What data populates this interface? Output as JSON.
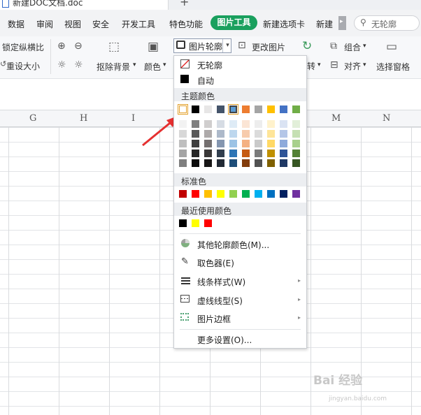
{
  "window": {
    "doc_tab_title": "新建DOC文档.doc",
    "add_tab": "+"
  },
  "menu": {
    "items": [
      "数据",
      "审阅",
      "视图",
      "安全",
      "开发工具",
      "特色功能",
      "图片工具",
      "新建选项卡",
      "新建"
    ],
    "active": "图片工具",
    "more_arrow": "▸",
    "search_placeholder": "无轮廓"
  },
  "ribbon": {
    "lock_ratio": "锁定纵横比",
    "reset_size": "重设大小",
    "remove_bg": "抠除背景",
    "color": "颜色",
    "outline": "图片轮廓",
    "change_picture": "更改图片",
    "combine": "组合",
    "align": "对齐",
    "selection_pane": "选择窗格",
    "rotate": "转",
    "dropdown_glyph": "▾"
  },
  "columns": [
    "G",
    "H",
    "I",
    "M",
    "N"
  ],
  "outline_menu": {
    "no_outline": "无轮廓",
    "automatic": "自动",
    "theme_colors_header": "主题颜色",
    "standard_colors_header": "标准色",
    "recent_colors_header": "最近使用颜色",
    "more_colors": "其他轮廓颜色(M)...",
    "eyedropper": "取色器(E)",
    "line_style": "线条样式(W)",
    "dash_style": "虚线线型(S)",
    "picture_border": "图片边框",
    "more_settings": "更多设置(O)...",
    "submenu_arrow": "▸",
    "theme_top": [
      "#ffffff",
      "#000000",
      "#e7e6e6",
      "#44546a",
      "#5b9bd5",
      "#ed7d31",
      "#a5a5a5",
      "#ffc000",
      "#4472c4",
      "#70ad47"
    ],
    "theme_tints": [
      [
        "#f2f2f2",
        "#7f7f7f",
        "#d0cece",
        "#d6dce4",
        "#deebf6",
        "#fbe5d5",
        "#ededed",
        "#fff2cc",
        "#dae3f3",
        "#e2efd9"
      ],
      [
        "#d8d8d8",
        "#595959",
        "#aeaaaa",
        "#adb9ca",
        "#bdd7ee",
        "#f7cbac",
        "#dbdbdb",
        "#fee599",
        "#b4c6e7",
        "#c5e0b3"
      ],
      [
        "#bfbfbf",
        "#3f3f3f",
        "#757070",
        "#8496b0",
        "#9cc3e5",
        "#f4b183",
        "#c9c9c9",
        "#ffd965",
        "#8eaadb",
        "#a8d08d"
      ],
      [
        "#a5a5a5",
        "#262626",
        "#3a3838",
        "#323f4f",
        "#2e75b5",
        "#c55a11",
        "#7b7b7b",
        "#bf9000",
        "#2f5496",
        "#538135"
      ],
      [
        "#7f7f7f",
        "#0c0c0c",
        "#171616",
        "#222a35",
        "#1e4e79",
        "#833c0b",
        "#525252",
        "#7f6000",
        "#1f3864",
        "#375623"
      ]
    ],
    "standard": [
      "#c00000",
      "#ff0000",
      "#ffc000",
      "#ffff00",
      "#92d050",
      "#00b050",
      "#00b0f0",
      "#0070c0",
      "#002060",
      "#7030a0"
    ],
    "recent": [
      "#000000",
      "#ffff00",
      "#ff0000"
    ]
  },
  "watermark": {
    "main": "Bai 经验",
    "sub": "jingyan.baidu.com"
  }
}
